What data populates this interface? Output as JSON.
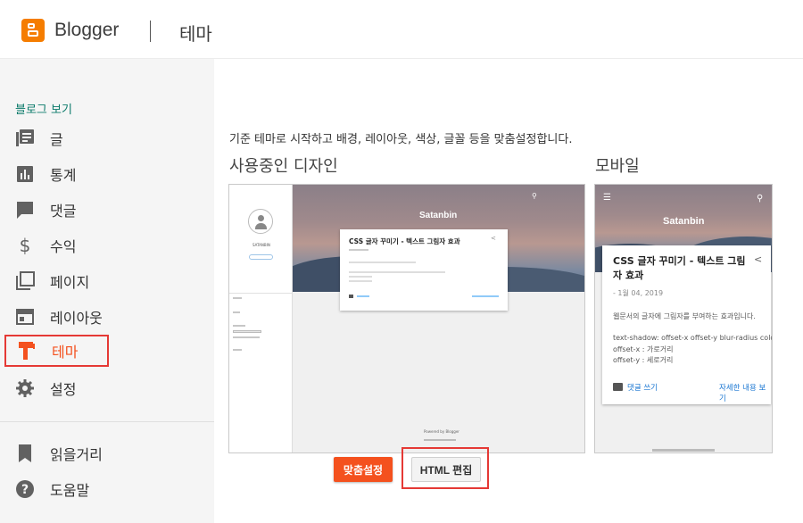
{
  "header": {
    "brand": "Blogger",
    "section": "테마"
  },
  "sidebar": {
    "view_blog": "블로그 보기",
    "items": [
      {
        "label": "글",
        "icon": "posts-icon"
      },
      {
        "label": "통계",
        "icon": "stats-icon"
      },
      {
        "label": "댓글",
        "icon": "comments-icon"
      },
      {
        "label": "수익",
        "icon": "dollar-icon"
      },
      {
        "label": "페이지",
        "icon": "pages-icon"
      },
      {
        "label": "레이아웃",
        "icon": "layout-icon"
      },
      {
        "label": "테마",
        "icon": "theme-icon",
        "active": true
      },
      {
        "label": "설정",
        "icon": "gear-icon"
      }
    ],
    "items2": [
      {
        "label": "읽을거리",
        "icon": "bookmark-icon"
      },
      {
        "label": "도움말",
        "icon": "help-icon"
      }
    ]
  },
  "main": {
    "description": "기준 테마로 시작하고 배경, 레이아웃, 색상, 글꼴 등을 맞춤설정합니다.",
    "current_design": "사용중인 디자인",
    "mobile": "모바일"
  },
  "preview": {
    "blog_title": "Satanbin",
    "post_title": "CSS 글자 꾸미기 - 텍스트 그림자 효과",
    "desktop_name": "SATANBIN",
    "desktop_powered": "Powered by Blogger",
    "mobile_date": "- 1월 04, 2019",
    "mobile_lines": [
      "웹문서의 글자에 그림자를 부여하는 효과입니다.",
      "text-shadow: offset-x offset-y blur-radius color",
      "offset-x : 가로거리",
      "offset-y : 세로거리"
    ],
    "mobile_comment": "댓글 쓰기",
    "mobile_more": "자세한 내용 보기"
  },
  "buttons": {
    "customize": "맞춤설정",
    "edit_html": "HTML 편집"
  },
  "colors": {
    "accent": "#f4511e",
    "highlight_border": "#e53935",
    "brand": "#f57d00",
    "link": "#1976d2"
  }
}
